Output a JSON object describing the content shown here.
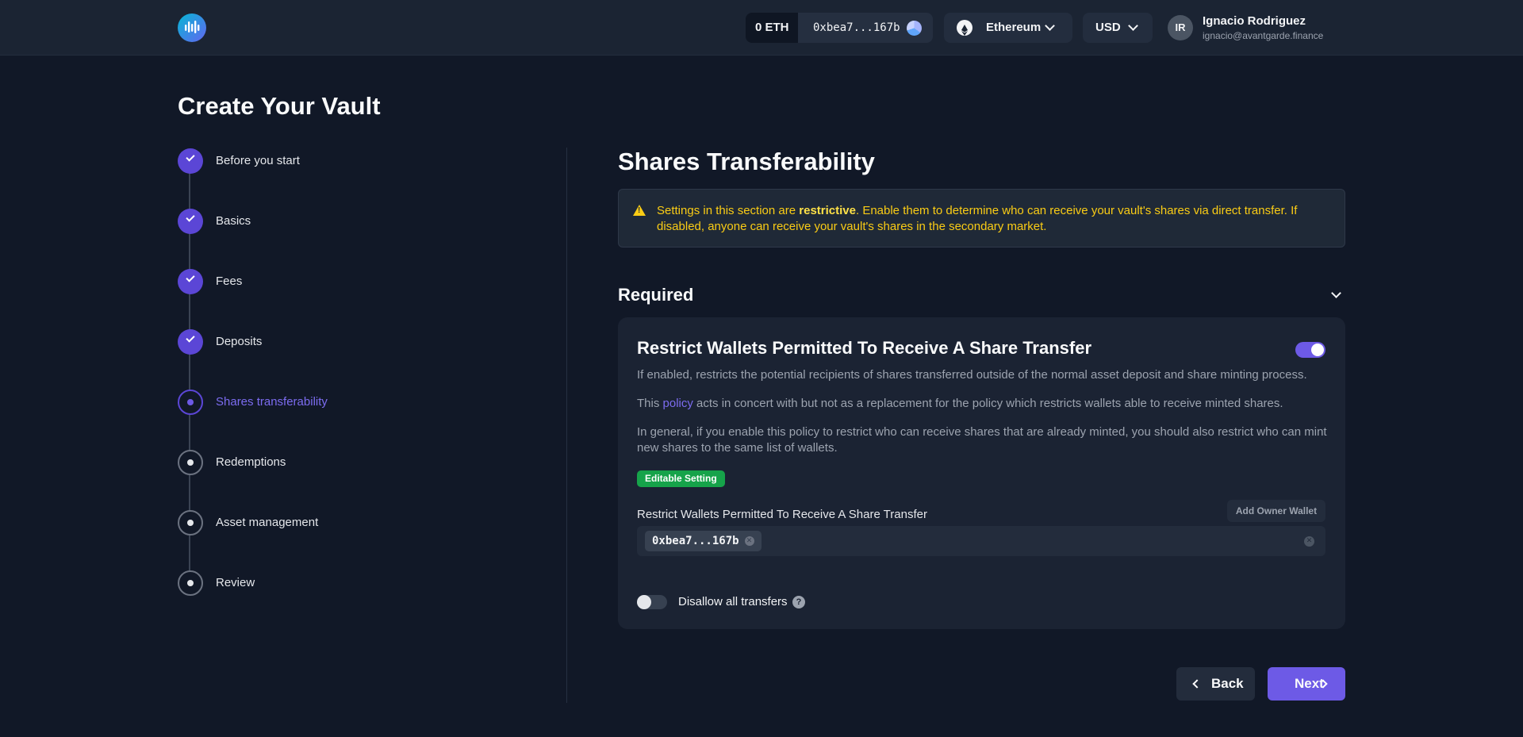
{
  "header": {
    "eth_balance": "0 ETH",
    "wallet_address": "0xbea7...167b",
    "network": "Ethereum",
    "currency": "USD",
    "user_initials": "IR",
    "user_name": "Ignacio Rodriguez",
    "user_email": "ignacio@avantgarde.finance"
  },
  "page_title": "Create Your Vault",
  "steps": [
    {
      "label": "Before you start",
      "state": "done"
    },
    {
      "label": "Basics",
      "state": "done"
    },
    {
      "label": "Fees",
      "state": "done"
    },
    {
      "label": "Deposits",
      "state": "done"
    },
    {
      "label": "Shares transferability",
      "state": "active"
    },
    {
      "label": "Redemptions",
      "state": "todo"
    },
    {
      "label": "Asset management",
      "state": "todo"
    },
    {
      "label": "Review",
      "state": "todo"
    }
  ],
  "section": {
    "title": "Shares Transferability",
    "alert_prefix": "Settings in this section are ",
    "alert_bold": "restrictive",
    "alert_suffix": ". Enable them to determine who can receive your vault's shares via direct transfer. If disabled, anyone can receive your vault's shares in the secondary market."
  },
  "required": {
    "title": "Required"
  },
  "policy_card": {
    "title": "Restrict Wallets Permitted To Receive A Share Transfer",
    "enabled": true,
    "desc1": "If enabled, restricts the potential recipients of shares transferred outside of the normal asset deposit and share minting process.",
    "desc2_prefix": "This ",
    "desc2_link": "policy",
    "desc2_suffix": " acts in concert with but not as a replacement for the policy which restricts wallets able to receive minted shares.",
    "desc3": "In general, if you enable this policy to restrict who can receive shares that are already minted, you should also restrict who can mint new shares to the same list of wallets.",
    "badge": "Editable Setting",
    "field_label": "Restrict Wallets Permitted To Receive A Share Transfer",
    "add_owner_label": "Add Owner Wallet",
    "addresses": [
      "0xbea7...167b"
    ],
    "disallow_label": "Disallow all transfers",
    "disallow_enabled": false
  },
  "buttons": {
    "back": "Back",
    "next": "Next"
  },
  "colors": {
    "accent": "#6d5ae6",
    "warning": "#facc15",
    "success_badge": "#16a34a",
    "background": "#111827"
  }
}
